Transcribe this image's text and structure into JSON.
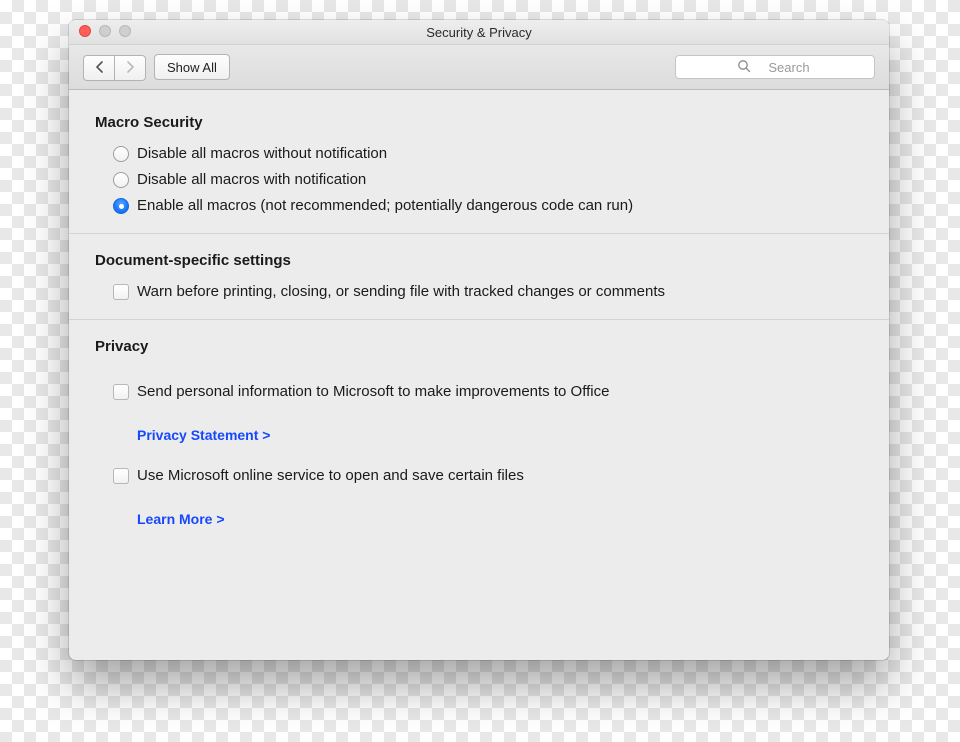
{
  "window": {
    "title": "Security & Privacy"
  },
  "toolbar": {
    "show_all": "Show All",
    "search_placeholder": "Search"
  },
  "sections": {
    "macro": {
      "heading": "Macro Security",
      "options": [
        "Disable all macros without notification",
        "Disable all macros with notification",
        "Enable all macros (not recommended; potentially dangerous code can run)"
      ],
      "selected_index": 2
    },
    "doc": {
      "heading": "Document-specific settings",
      "checkbox": "Warn before printing, closing, or sending file with tracked changes or comments"
    },
    "privacy": {
      "heading": "Privacy",
      "send_info": "Send personal information to Microsoft to make improvements to Office",
      "privacy_statement": "Privacy Statement >",
      "use_online": "Use Microsoft online service to open and save certain files",
      "learn_more": "Learn More >"
    }
  }
}
